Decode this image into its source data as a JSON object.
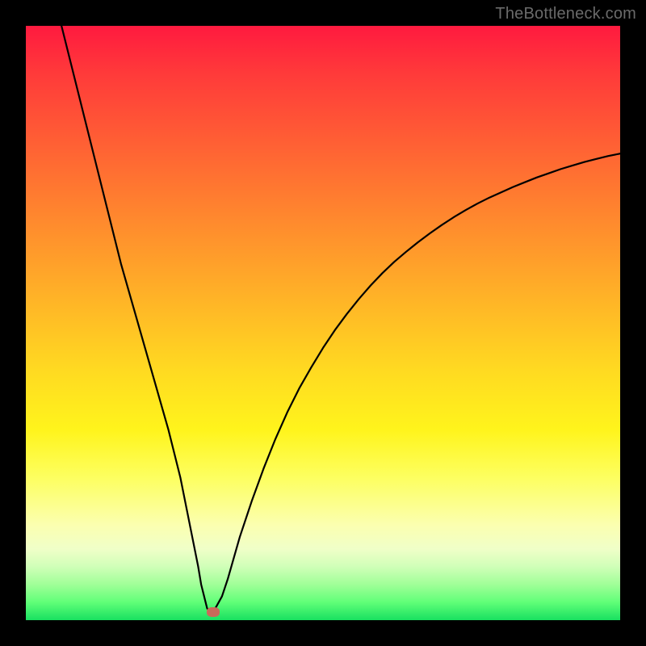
{
  "watermark": "TheBottleneck.com",
  "chart_data": {
    "type": "line",
    "title": "",
    "xlabel": "",
    "ylabel": "",
    "xlim": [
      0,
      100
    ],
    "ylim": [
      0,
      100
    ],
    "grid": false,
    "series": [
      {
        "name": "curve",
        "x": [
          6,
          8,
          10,
          12,
          14,
          16,
          18,
          20,
          22,
          24,
          26,
          27,
          28,
          29,
          29.5,
          30,
          30.5,
          31,
          31.5,
          32,
          33,
          34,
          35,
          36,
          38,
          40,
          42,
          44,
          46,
          48,
          50,
          52,
          54,
          56,
          58,
          60,
          62,
          64,
          66,
          68,
          70,
          72,
          74,
          76,
          78,
          80,
          82,
          84,
          86,
          88,
          90,
          92,
          94,
          96,
          98,
          100
        ],
        "y": [
          100,
          92,
          84,
          76,
          68,
          60,
          53,
          46,
          39,
          32,
          24,
          19,
          14,
          9,
          6,
          4,
          2,
          1.2,
          1.6,
          2.2,
          4,
          7,
          10.5,
          14,
          20,
          25.5,
          30.5,
          35,
          39,
          42.5,
          45.8,
          48.8,
          51.5,
          54,
          56.3,
          58.4,
          60.3,
          62,
          63.6,
          65.1,
          66.5,
          67.8,
          69,
          70.1,
          71.1,
          72,
          72.9,
          73.7,
          74.5,
          75.2,
          75.9,
          76.5,
          77.1,
          77.6,
          78.1,
          78.5
        ]
      }
    ],
    "marker": {
      "x": 31.5,
      "y": 1.3,
      "color": "#c96a5a"
    },
    "background_gradient": [
      "#ff1a3f",
      "#ffda21",
      "#18e060"
    ]
  }
}
